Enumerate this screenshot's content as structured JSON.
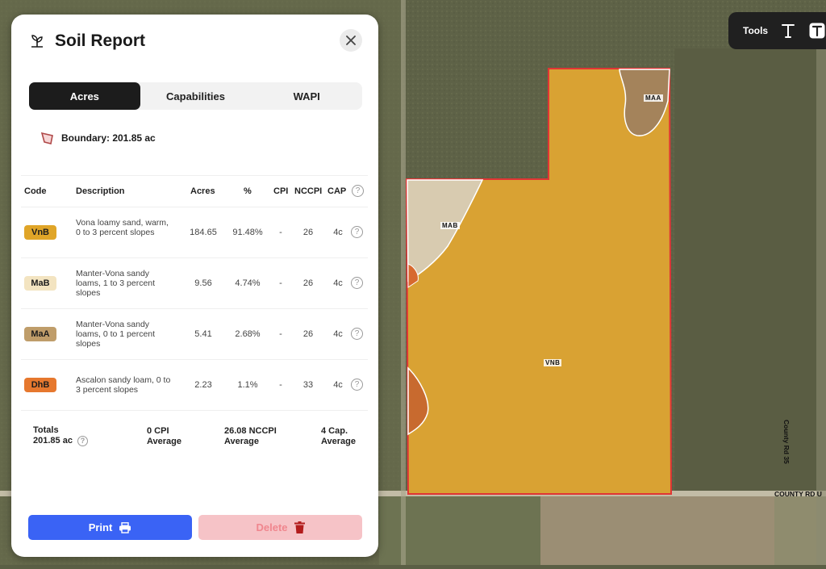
{
  "panel": {
    "title": "Soil Report",
    "tabs": [
      {
        "label": "Acres",
        "active": true
      },
      {
        "label": "Capabilities",
        "active": false
      },
      {
        "label": "WAPI",
        "active": false
      }
    ],
    "boundary_text": "Boundary: 201.85 ac",
    "table": {
      "headers": [
        "Code",
        "Description",
        "Acres",
        "%",
        "CPI",
        "NCCPI",
        "CAP"
      ],
      "rows": [
        {
          "code": "VnB",
          "color": "#e0a528",
          "description": "Vona loamy sand, warm, 0 to 3 percent slopes",
          "acres": "184.65",
          "percent": "91.48%",
          "cpi": "-",
          "nccpi": "26",
          "cap": "4c"
        },
        {
          "code": "MaB",
          "color": "#f3e4c1",
          "description": "Manter-Vona sandy loams, 1 to 3 percent slopes",
          "acres": "9.56",
          "percent": "4.74%",
          "cpi": "-",
          "nccpi": "26",
          "cap": "4c"
        },
        {
          "code": "MaA",
          "color": "#bf9d6a",
          "description": "Manter-Vona sandy loams, 0 to 1 percent slopes",
          "acres": "5.41",
          "percent": "2.68%",
          "cpi": "-",
          "nccpi": "26",
          "cap": "4c"
        },
        {
          "code": "DhB",
          "color": "#e6782e",
          "description": "Ascalon sandy loam, 0 to 3 percent slopes",
          "acres": "2.23",
          "percent": "1.1%",
          "cpi": "-",
          "nccpi": "33",
          "cap": "4c"
        }
      ],
      "totals": {
        "label": "Totals",
        "acres": "201.85 ac",
        "cpi_value": "0 CPI",
        "cpi_sub": "Average",
        "nccpi_value": "26.08 NCCPI",
        "nccpi_sub": "Average",
        "cap_value": "4 Cap.",
        "cap_sub": "Average"
      }
    },
    "buttons": {
      "print": "Print",
      "delete": "Delete"
    }
  },
  "tools": {
    "label": "Tools"
  },
  "map": {
    "labels": {
      "maa": "MAA",
      "mab": "MAB",
      "vnb": "VNB"
    },
    "roads": {
      "county_rd_u": "COUNTY RD U",
      "county_rd_35": "County Rd 35",
      "bottom": "COUNTY RD U"
    }
  },
  "colors": {
    "print": "#3a63f5",
    "delete": "#f6c3c7",
    "boundary": "#e03535"
  }
}
